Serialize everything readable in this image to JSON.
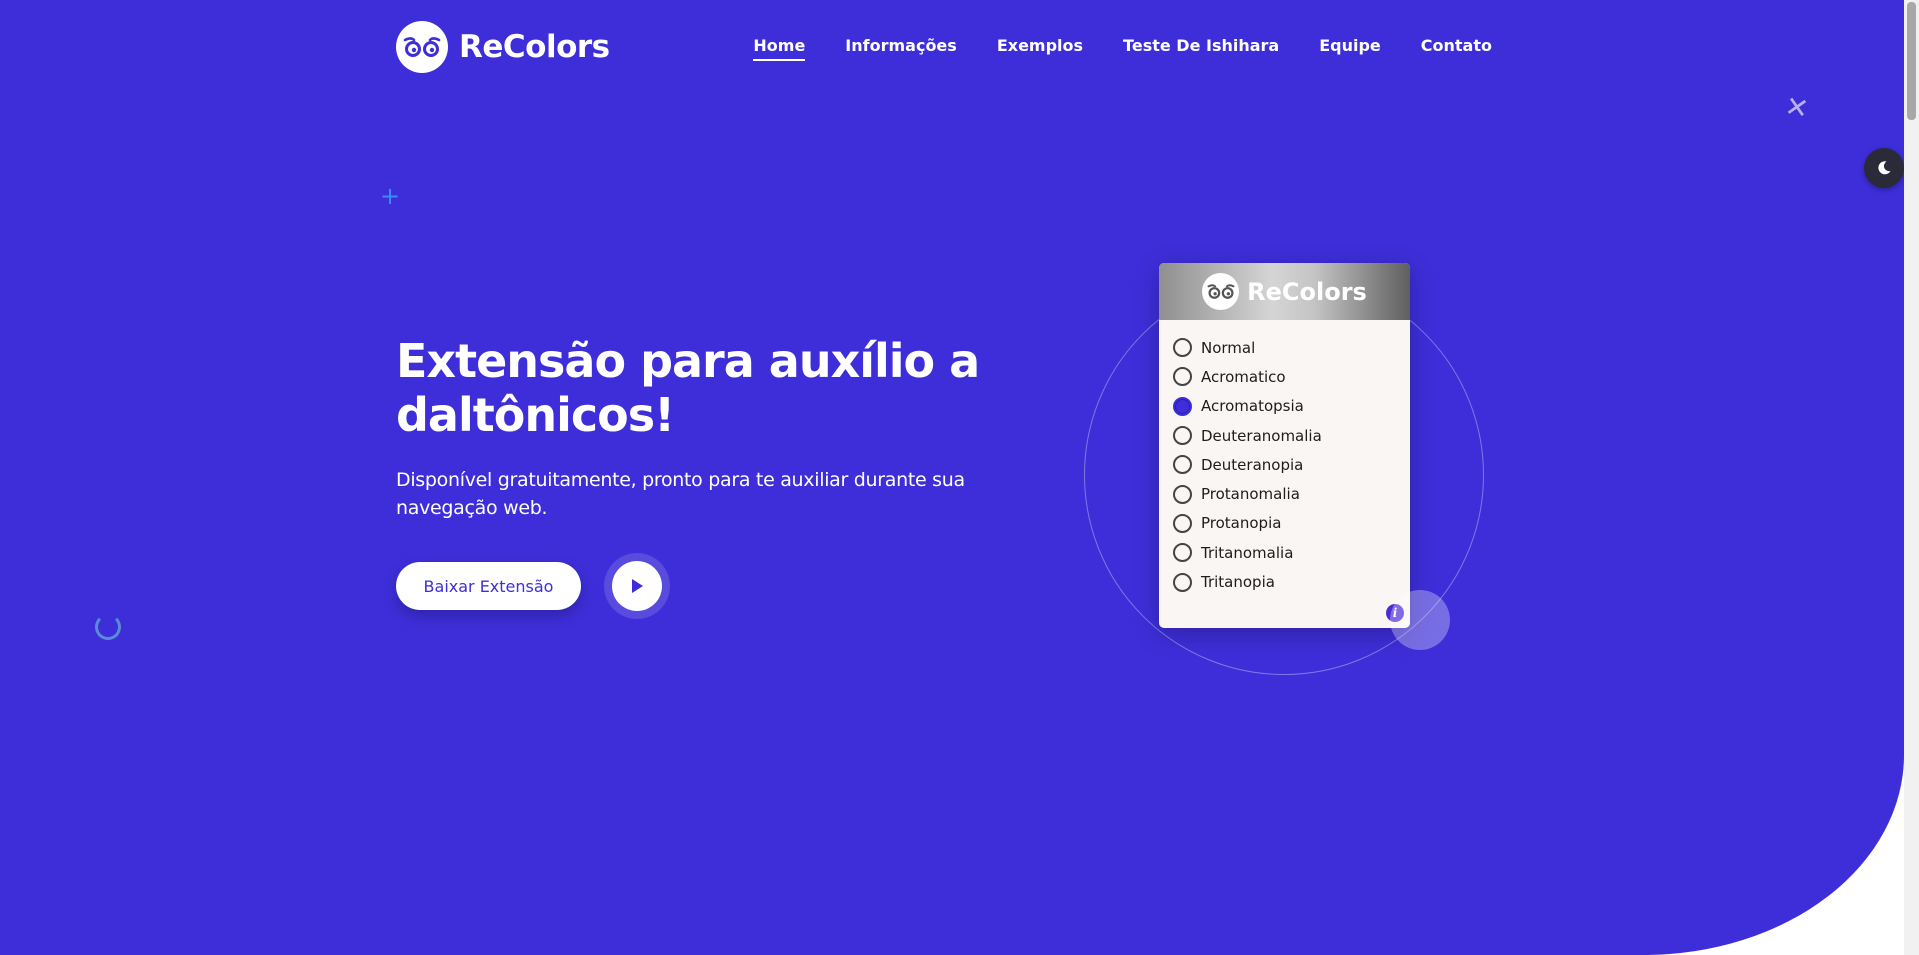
{
  "header": {
    "logo_text": "ReColors",
    "nav": [
      {
        "label": "Home",
        "active": true
      },
      {
        "label": "Informações"
      },
      {
        "label": "Exemplos"
      },
      {
        "label": "Teste De Ishihara"
      },
      {
        "label": "Equipe"
      },
      {
        "label": "Contato"
      }
    ]
  },
  "hero": {
    "title": "Extensão para auxílio a daltônicos!",
    "subtitle": "Disponível gratuitamente, pronto para te auxiliar durante sua navegação web.",
    "download_label": "Baixar Extensão"
  },
  "popup": {
    "logo_text": "ReColors",
    "options": [
      {
        "label": "Normal",
        "checked": false
      },
      {
        "label": "Acromatico",
        "checked": false
      },
      {
        "label": "Acromatopsia",
        "checked": true
      },
      {
        "label": "Deuteranomalia",
        "checked": false
      },
      {
        "label": "Deuteranopia",
        "checked": false
      },
      {
        "label": "Protanomalia",
        "checked": false
      },
      {
        "label": "Protanopia",
        "checked": false
      },
      {
        "label": "Tritanomalia",
        "checked": false
      },
      {
        "label": "Tritanopia",
        "checked": false
      }
    ],
    "info_glyph": "i"
  },
  "icons": [
    "logo-owl-icon",
    "play-icon",
    "info-icon",
    "moon-icon",
    "plus-icon",
    "ring-icon",
    "cross-icon"
  ],
  "colors": {
    "primary": "#3d2ed9",
    "white": "#ffffff",
    "popup_bg": "#faf6f4",
    "dark_toggle": "#2a2a38"
  }
}
